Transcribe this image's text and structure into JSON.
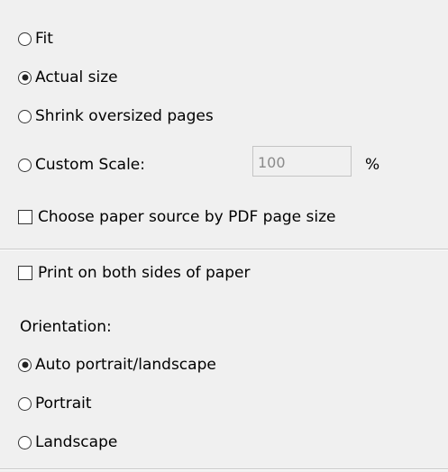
{
  "scaling": {
    "options": [
      {
        "label": "Fit",
        "checked": false
      },
      {
        "label": "Actual size",
        "checked": true
      },
      {
        "label": "Shrink oversized pages",
        "checked": false
      },
      {
        "label": "Custom Scale:",
        "checked": false
      }
    ],
    "custom_scale_value": "100",
    "custom_scale_unit": "%",
    "paper_source_label": "Choose paper source by PDF page size"
  },
  "duplex": {
    "label": "Print on both sides of paper"
  },
  "orientation": {
    "heading": "Orientation:",
    "options": [
      {
        "label": "Auto portrait/landscape",
        "checked": true
      },
      {
        "label": "Portrait",
        "checked": false
      },
      {
        "label": "Landscape",
        "checked": false
      }
    ]
  }
}
